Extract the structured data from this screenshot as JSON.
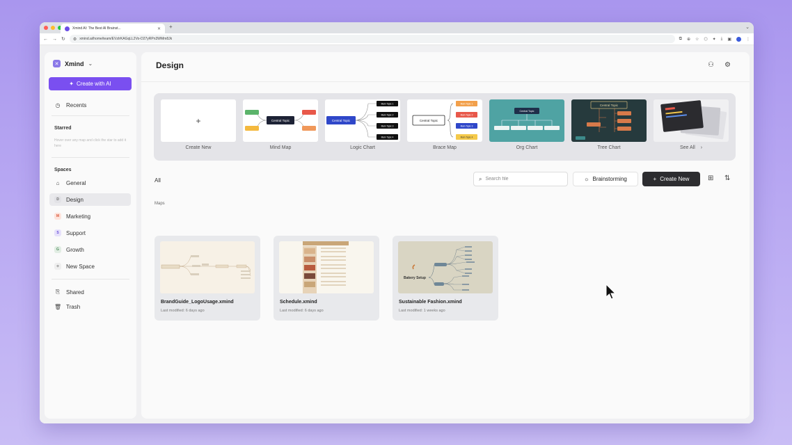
{
  "browser": {
    "tab_title": "Xmind AI: The Best AI Brainst...",
    "url": "xmind.ai/home/team/EVzIrKAGqLL2Vo-D27yRPn3WMm8Jk"
  },
  "sidebar": {
    "brand": "Xmind",
    "ai_button": "Create with AI",
    "recents": "Recents",
    "starred_label": "Starred",
    "starred_hint": "Hover over any map and click the star to add it here",
    "spaces_label": "Spaces",
    "spaces": [
      {
        "label": "General"
      },
      {
        "label": "Design",
        "badge": "D",
        "badge_color": "#e8e8ea"
      },
      {
        "label": "Marketing",
        "badge": "M",
        "badge_color": "#fde4dc"
      },
      {
        "label": "Support",
        "badge": "S",
        "badge_color": "#e6e1fb"
      },
      {
        "label": "Growth",
        "badge": "G",
        "badge_color": "#e1ede3"
      },
      {
        "label": "New Space"
      }
    ],
    "shared": "Shared",
    "trash": "Trash"
  },
  "main": {
    "title": "Design",
    "templates": [
      {
        "label": "Create New"
      },
      {
        "label": "Mind Map"
      },
      {
        "label": "Logic Chart"
      },
      {
        "label": "Brace Map"
      },
      {
        "label": "Org Chart"
      },
      {
        "label": "Tree Chart"
      },
      {
        "label": "See All"
      }
    ],
    "template_text": {
      "central_topic": "Central Topic",
      "main_topic_1": "Main Topic 1",
      "main_topic_2": "Main Topic 2",
      "main_topic_3": "Main Topic 3",
      "main_topic_4": "Main Topic 4"
    },
    "filter_label": "All",
    "search_placeholder": "Search file",
    "brainstorm_button": "Brainstorming",
    "create_button": "Create New",
    "section_label": "Maps",
    "files": [
      {
        "name": "BrandGuide_LogoUsage.xmind",
        "modified": "Last modified: 6 days ago"
      },
      {
        "name": "Schedule.xmind",
        "modified": "Last modified: 6 days ago"
      },
      {
        "name": "Sustainable Fashion.xmind",
        "modified": "Last modified: 1 weeks ago",
        "thumb_label": "Bakery Setup"
      }
    ]
  }
}
